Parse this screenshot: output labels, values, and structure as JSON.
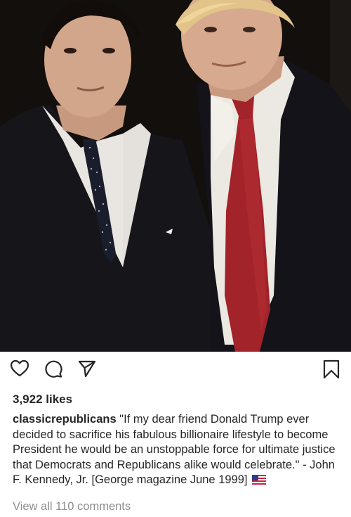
{
  "post": {
    "likes": "3,922 likes",
    "username": "classicrepublicans",
    "caption": " \"If my dear friend Donald Trump ever decided to sacrifice his fabulous billionaire lifestyle to become President he would be an unstoppable force for ultimate justice that Democrats and Republicans alike would celebrate.\" - John F. Kennedy, Jr. [George magazine June 1999] ",
    "view_comments": "View all 110 comments"
  },
  "icons": {
    "like": "heart-icon",
    "comment": "comment-icon",
    "share": "share-icon",
    "save": "bookmark-icon",
    "flag": "us-flag-emoji"
  },
  "colors": {
    "text": "#262626",
    "muted": "#8e8e8e",
    "background": "#ffffff"
  }
}
